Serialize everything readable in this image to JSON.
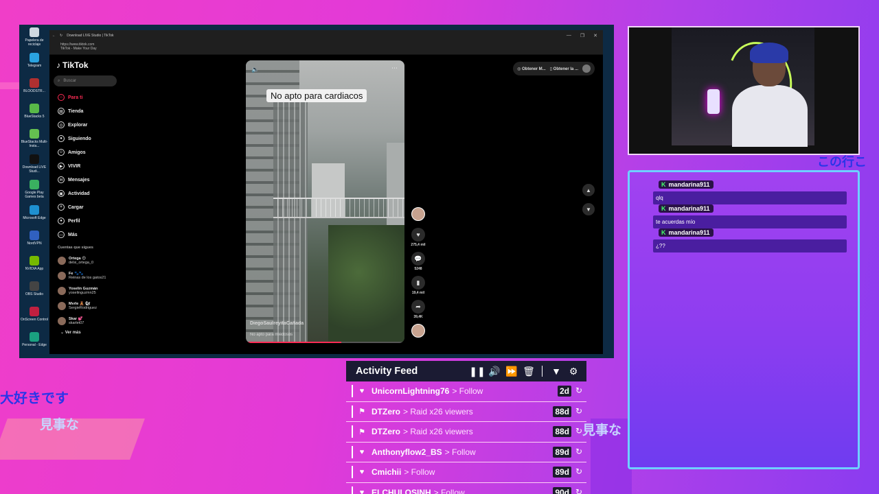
{
  "background": {
    "jp_left_1": "大好きです",
    "jp_left_2": "見事な",
    "jp_mid": "見事な",
    "jp_corner": "この行こ"
  },
  "desktop": {
    "icons": [
      {
        "label": "Papelera de reciclaje",
        "color": "#cfd8e0"
      },
      {
        "label": "Telegram",
        "color": "#2aa3e0"
      },
      {
        "label": "BLOODSTR...",
        "color": "#b03030"
      },
      {
        "label": "BlueStacks 5",
        "color": "#58b848"
      },
      {
        "label": "BlueStacks Multi-Insta...",
        "color": "#64c050"
      },
      {
        "label": "Download LIVE Studi...",
        "color": "#111111"
      },
      {
        "label": "Google Play Games beta",
        "color": "#3ab060"
      },
      {
        "label": "Microsoft Edge",
        "color": "#1e90d0"
      },
      {
        "label": "NordVPN",
        "color": "#3060c0"
      },
      {
        "label": "NVIDIA App",
        "color": "#76b900"
      },
      {
        "label": "OBS Studio",
        "color": "#444444"
      },
      {
        "label": "OnScreen Control",
        "color": "#c02040"
      },
      {
        "label": "Personal - Edge",
        "color": "#1aa080"
      }
    ]
  },
  "browser": {
    "tab_title": "Download LIVE Studio | TikTok",
    "url": "https://www.tiktok.com",
    "page_title": "TikTok - Make Your Day",
    "controls": [
      "—",
      "❐",
      "✕"
    ]
  },
  "tiktok": {
    "logo": "TikTok",
    "search_placeholder": "Buscar",
    "nav": [
      {
        "label": "Para ti",
        "icon": "⌂",
        "active": true
      },
      {
        "label": "Tienda",
        "icon": "▤"
      },
      {
        "label": "Explorar",
        "icon": "◎"
      },
      {
        "label": "Siguiendo",
        "icon": "●"
      },
      {
        "label": "Amigos",
        "icon": "☺"
      },
      {
        "label": "VIVIR",
        "icon": "▶"
      },
      {
        "label": "Mensajes",
        "icon": "✉"
      },
      {
        "label": "Actividad",
        "icon": "▣"
      },
      {
        "label": "Cargar",
        "icon": "+"
      },
      {
        "label": "Perfil",
        "icon": "●"
      },
      {
        "label": "Más",
        "icon": "…"
      }
    ],
    "following_heading": "Cuentas que sigues",
    "accounts": [
      {
        "name": "Ortega 😊",
        "handle": "delsi_ortega_0"
      },
      {
        "name": "Fe 🐾🐾",
        "handle": "Reinas de los gatos21"
      },
      {
        "name": "Yoselin Guzmán",
        "handle": "yoselinguzmn25"
      },
      {
        "name": "Mvrle 🧸 🐿",
        "handle": "SergieRodriguez"
      },
      {
        "name": "Skar 💕",
        "handle": "skarlet07"
      }
    ],
    "see_more": "Ver más",
    "top_buttons": {
      "left": "Obtener M...",
      "right": "Obtener la ..."
    },
    "video": {
      "caption": "No apto para cardiacos",
      "username": "DiegoSaulreyitaCañada",
      "description": "No apto para miedosos",
      "progress": 0.6
    },
    "stats": {
      "likes": "275,4 mil",
      "comments": "5248",
      "saves": "19,4 mil",
      "shares": "39,4K"
    }
  },
  "chat": {
    "messages": [
      {
        "user": "mandarina911",
        "badge": "K",
        "text": "qlq"
      },
      {
        "user": "mandarina911",
        "badge": "K",
        "text": "te acuerdas mío"
      },
      {
        "user": "mandarina911",
        "badge": "K",
        "text": "¿??"
      }
    ]
  },
  "activity_feed": {
    "title": "Activity Feed",
    "items": [
      {
        "icon": "heart-icon",
        "user": "UnicornLightning76",
        "action": "> Follow",
        "age": "2d"
      },
      {
        "icon": "raid-icon",
        "user": "DTZero",
        "action": "> Raid x26 viewers",
        "age": "88d"
      },
      {
        "icon": "raid-icon",
        "user": "DTZero",
        "action": "> Raid x26 viewers",
        "age": "88d"
      },
      {
        "icon": "heart-icon",
        "user": "Anthonyflow2_BS",
        "action": "> Follow",
        "age": "89d"
      },
      {
        "icon": "heart-icon",
        "user": "Cmichii",
        "action": "> Follow",
        "age": "89d"
      },
      {
        "icon": "heart-icon",
        "user": "ELCHULOSINH",
        "action": "> Follow",
        "age": "90d"
      }
    ]
  }
}
